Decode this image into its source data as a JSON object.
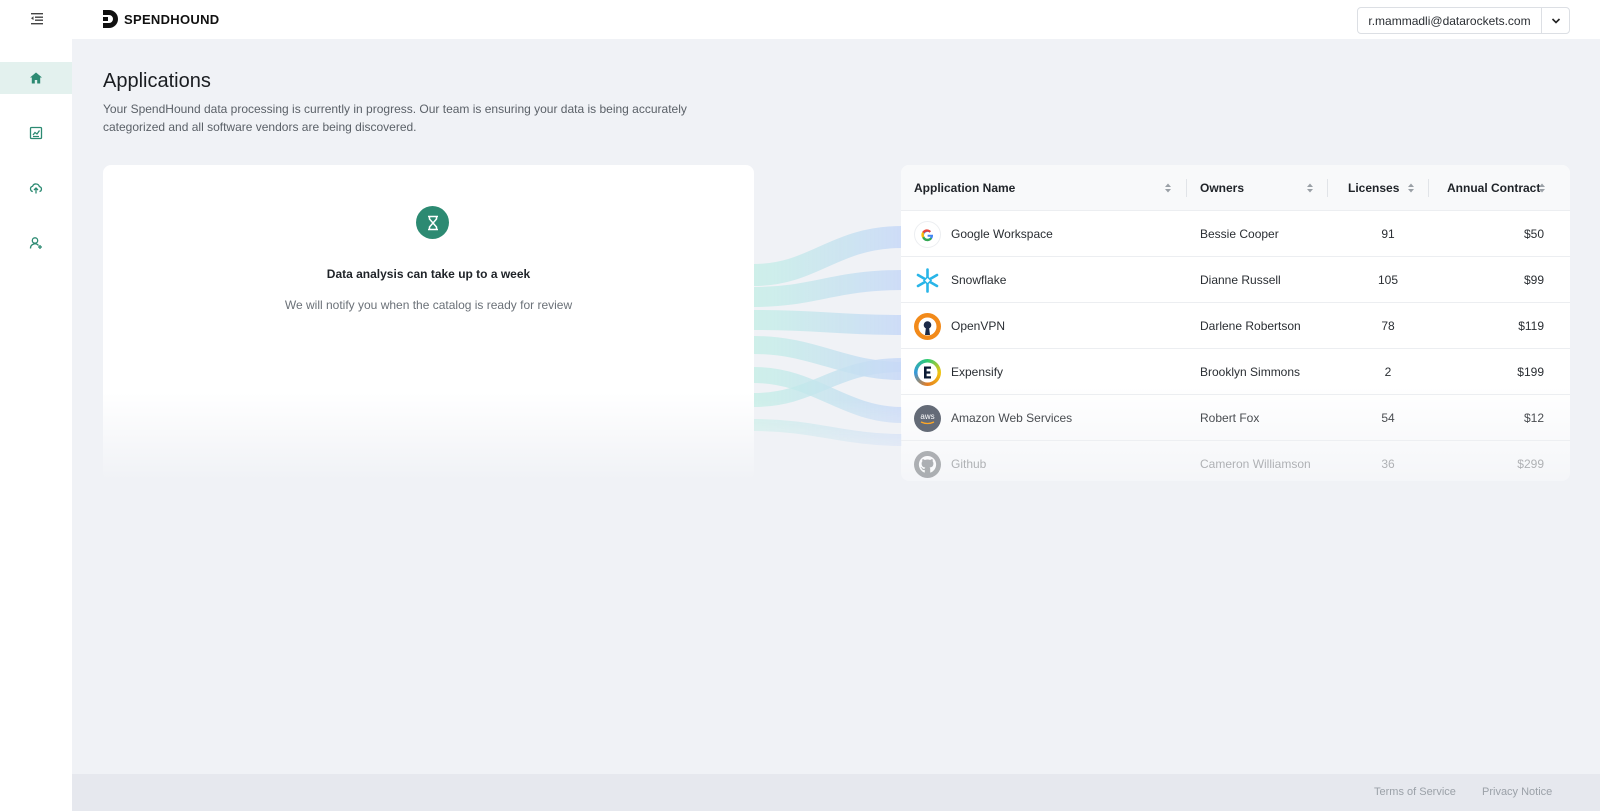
{
  "brand": {
    "name": "SPENDHOUND"
  },
  "user": {
    "email": "r.mammadli@datarockets.com"
  },
  "sidebar": {
    "items": [
      {
        "icon": "home-icon",
        "active": true
      },
      {
        "icon": "receipt-icon",
        "active": false
      },
      {
        "icon": "cloud-upload-icon",
        "active": false
      },
      {
        "icon": "user-add-icon",
        "active": false
      }
    ]
  },
  "page": {
    "title": "Applications",
    "description": "Your SpendHound data processing is currently in progress. Our team is ensuring your data is being accurately categorized and all software vendors are being discovered."
  },
  "status": {
    "heading": "Data analysis can take up to a week",
    "subtext": "We will notify you when the catalog is ready for review"
  },
  "table": {
    "columns": [
      "Application Name",
      "Owners",
      "Licenses",
      "Annual Contract"
    ],
    "rows": [
      {
        "name": "Google Workspace",
        "owner": "Bessie Cooper",
        "licenses": "91",
        "contract": "$50",
        "logo": "google-logo-icon"
      },
      {
        "name": "Snowflake",
        "owner": "Dianne Russell",
        "licenses": "105",
        "contract": "$99",
        "logo": "snowflake-logo-icon"
      },
      {
        "name": "OpenVPN",
        "owner": "Darlene Robertson",
        "licenses": "78",
        "contract": "$119",
        "logo": "openvpn-logo-icon"
      },
      {
        "name": "Expensify",
        "owner": "Brooklyn Simmons",
        "licenses": "2",
        "contract": "$199",
        "logo": "expensify-logo-icon"
      },
      {
        "name": "Amazon Web Services",
        "owner": "Robert Fox",
        "licenses": "54",
        "contract": "$12",
        "logo": "aws-logo-icon"
      },
      {
        "name": "Github",
        "owner": "Cameron Williamson",
        "licenses": "36",
        "contract": "$299",
        "logo": "github-logo-icon"
      }
    ]
  },
  "footer": {
    "terms": "Terms of Service",
    "privacy": "Privacy Notice"
  },
  "colors": {
    "accent": "#2c8a72",
    "background": "#f0f2f6"
  }
}
